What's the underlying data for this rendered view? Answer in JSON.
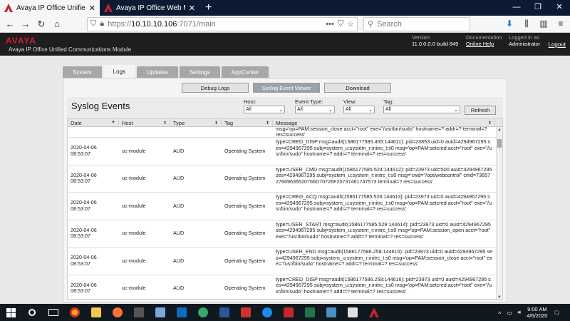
{
  "browser": {
    "tabs": [
      {
        "title": "Avaya IP Office Unified Commu",
        "active": true
      },
      {
        "title": "Avaya IP Office Web Manager",
        "active": false
      }
    ],
    "url_scheme": "https://",
    "url_host": "10.10.10.106",
    "url_rest": ":7071/main",
    "search_placeholder": "Search"
  },
  "header": {
    "logo": "AVAYA",
    "app_name": "Avaya IP Office Unified Communications Module",
    "version_label": "Version",
    "version_value": "11.0.0.0.0 build 849",
    "doc_label": "Documentation",
    "doc_link": "Online Help",
    "login_label": "Logged in as",
    "login_value": "Administrator",
    "logout": "Logout"
  },
  "main_tabs": [
    {
      "label": "System",
      "active": false
    },
    {
      "label": "Logs",
      "active": true
    },
    {
      "label": "Updates",
      "active": false
    },
    {
      "label": "Settings",
      "active": false
    },
    {
      "label": "AppCenter",
      "active": false
    }
  ],
  "sub_tabs": [
    {
      "label": "Debug Logs",
      "active": false
    },
    {
      "label": "Syslog Event Viewer",
      "active": true
    },
    {
      "label": "Download",
      "active": false
    }
  ],
  "filters": {
    "title": "Syslog Events",
    "host": {
      "label": "Host:",
      "value": "All"
    },
    "event_type": {
      "label": "Event Type:",
      "value": "All"
    },
    "view": {
      "label": "View:",
      "value": "All"
    },
    "tag": {
      "label": "Tag:",
      "value": "All"
    },
    "refresh": "Refresh"
  },
  "columns": [
    "Date",
    "Host",
    "Type",
    "Tag",
    "Message"
  ],
  "partial_row": {
    "message": "msg='op=PAM:session_close acct=\"root\" exe=\"/usr/bin/sudo\" hostname=? addr=? terminal=? res=success'"
  },
  "rows": [
    {
      "date": "2020-04-06",
      "time": "08:53:07",
      "host": "uc-module",
      "type": "AUD",
      "tag": "Operating System",
      "message": "type=CRED_DISP msg=audit(1586177585.455:144611): pid=23853 uid=0 auid=4294967295 ses=4294967295 subj=system_u:system_r:initrc_t:s0 msg='op=PAM:setcred acct=\"root\" exe=\"/usr/bin/sudo\" hostname=? addr=? terminal=? res=success'"
    },
    {
      "date": "2020-04-06",
      "time": "08:53:07",
      "host": "uc-module",
      "type": "AUD",
      "tag": "Operating System",
      "message": "type=USER_CMD msg=audit(1586177585.524:144612): pid=23973 uid=500 auid=4294967295 ses=4294967295 subj=system_u:system_r:initrc_t:s0 msg='cwd=\"/opt/webcontrol\" cmd=7365727669636520766D70726F20737461747573 terminal=? res=success'"
    },
    {
      "date": "2020-04-06",
      "time": "08:53:07",
      "host": "uc-module",
      "type": "AUD",
      "tag": "Operating System",
      "message": "type=CRED_ACQ msg=audit(1586177585.526:144613): pid=23973 uid=0 auid=4294967295 ses=4294967295 subj=system_u:system_r:initrc_t:s0 msg='op=PAM:setcred acct=\"root\" exe=\"/usr/bin/sudo\" hostname=? addr=? terminal=? res=success'"
    },
    {
      "date": "2020-04-06",
      "time": "08:53:07",
      "host": "uc-module",
      "type": "AUD",
      "tag": "Operating System",
      "message": "type=USER_START msg=audit(1586177585.529:144614): pid=23973 uid=0 auid=4294967295 ses=4294967295 subj=system_u:system_r:initrc_t:s0 msg='op=PAM:session_open acct=\"root\" exe=\"/usr/bin/sudo\" hostname=? addr=? terminal=? res=success'"
    },
    {
      "date": "2020-04-06",
      "time": "08:53:07",
      "host": "uc-module",
      "type": "AUD",
      "tag": "Operating System",
      "message": "type=USER_END msg=audit(1586177586.258:144615): pid=23973 uid=0 auid=4294967295 ses=4294967295 subj=system_u:system_r:initrc_t:s0 msg='op=PAM:session_close acct=\"root\" exe=\"/usr/bin/sudo\" hostname=? addr=? terminal=? res=success'"
    },
    {
      "date": "2020-04-06",
      "time": "08:53:07",
      "host": "uc-module",
      "type": "AUD",
      "tag": "Operating System",
      "message": "type=CRED_DISP msg=audit(1586177586.259:144616): pid=23973 uid=0 auid=4294967295 ses=4294967295 subj=system_u:system_r:initrc_t:s0 msg='op=PAM:setcred acct=\"root\" exe=\"/usr/bin/sudo\" hostname=? addr=? terminal=? res=success'"
    }
  ],
  "taskbar": {
    "clock_time": "9:00 AM",
    "clock_date": "4/6/2020"
  },
  "colors": {
    "brand": "#cc1f2e",
    "header_bg": "#1e1e1e",
    "tab_gray": "#a7a7a7"
  }
}
